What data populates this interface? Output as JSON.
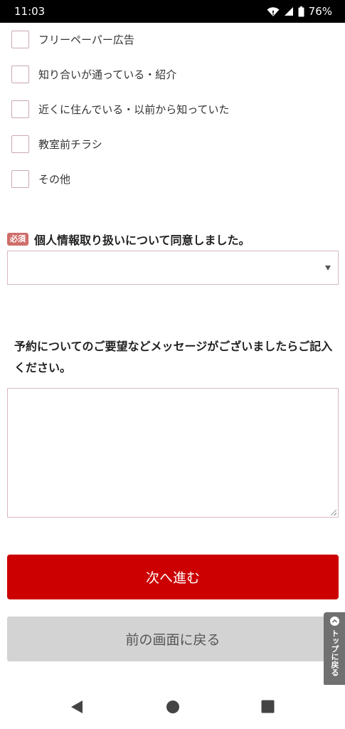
{
  "status_bar": {
    "time": "11:03",
    "battery": "76%"
  },
  "checkboxes": [
    {
      "label": "フリーペーパー広告",
      "checked": false
    },
    {
      "label": "知り合いが通っている・紹介",
      "checked": false
    },
    {
      "label": "近くに住んでいる・以前から知っていた",
      "checked": false
    },
    {
      "label": "教室前チラシ",
      "checked": false
    },
    {
      "label": "その他",
      "checked": false
    }
  ],
  "consent": {
    "badge": "必須",
    "label": "個人情報取り扱いについて同意しました。",
    "selected_value": ""
  },
  "message": {
    "label": "予約についてのご要望などメッセージがございましたらご記入ください。",
    "value": ""
  },
  "buttons": {
    "next": "次へ進む",
    "back": "前の画面に戻る"
  },
  "to_top": {
    "label": "トップに戻る"
  },
  "colors": {
    "primary": "#cc0000",
    "badge": "#cf6e6a",
    "secondary_button": "#d3d3d3"
  }
}
